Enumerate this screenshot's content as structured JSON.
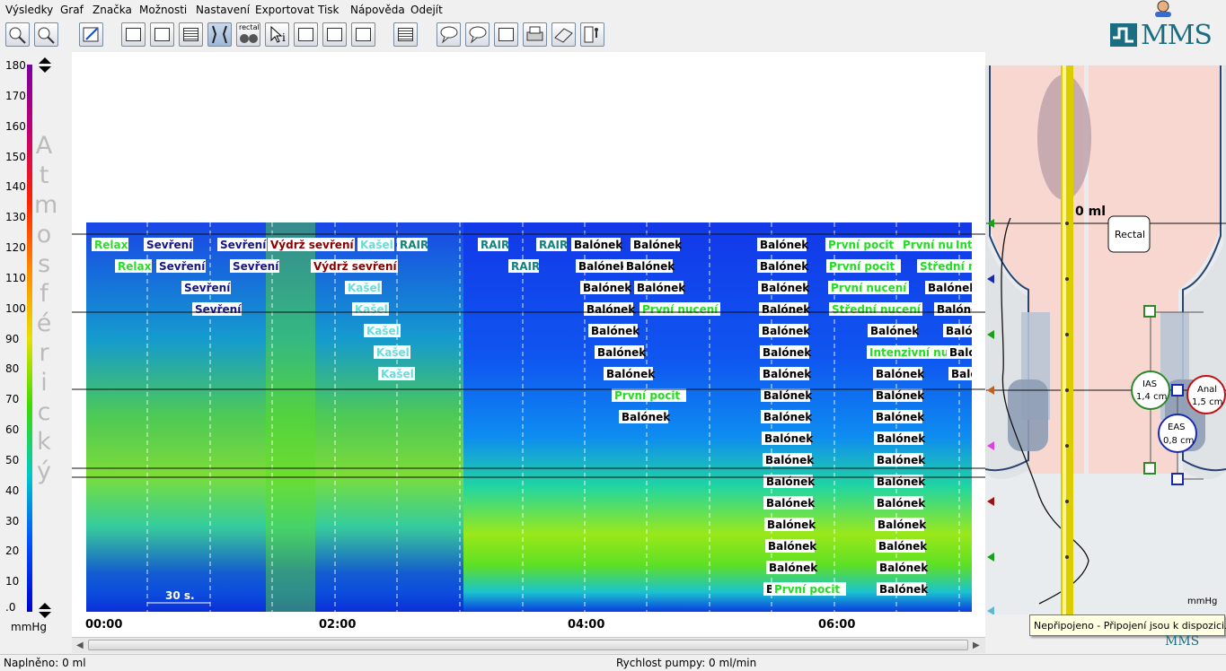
{
  "menu": [
    "Výsledky",
    "Graf",
    "Značka",
    "Možnosti",
    "Nastavení",
    "Exportovat",
    "Tisk",
    "Nápověda",
    "Odejít"
  ],
  "toolbar": {
    "rectal_label": "rectal",
    "logo_text": "MMS"
  },
  "yaxis": {
    "ticks": [
      "180",
      "170",
      "160",
      "150",
      "140",
      "130",
      "120",
      "110",
      "100",
      "90",
      "80",
      "70",
      "60",
      "50",
      "40",
      "30",
      "20",
      "10",
      ".0"
    ],
    "vertical_label": "A\nt\nm\no\ns\nf\né\nr\ni\nc\nk\ný",
    "unit": "mmHg"
  },
  "xaxis": {
    "ticks": [
      "00:00",
      "02:00",
      "04:00",
      "06:00"
    ]
  },
  "scale_label": "30 s.",
  "colors": {
    "accent": "#1a6e82",
    "relax": "#2bdc2b",
    "sevreni": "#14148c",
    "vydrz": "#8c0000",
    "kasel": "#66dddd",
    "rair": "#158080",
    "balonek": "#000000",
    "prvni": "#22dd22"
  },
  "markers": [
    {
      "label": "Relax",
      "color": "#2bdc2b"
    },
    {
      "label": "Relax",
      "color": "#2bdc2b"
    },
    {
      "label": "Sevření",
      "color": "#14148c"
    },
    {
      "label": "Sevření",
      "color": "#14148c"
    },
    {
      "label": "Sevření",
      "color": "#14148c"
    },
    {
      "label": "Sevření",
      "color": "#14148c"
    },
    {
      "label": "Sevření",
      "color": "#14148c"
    },
    {
      "label": "Sevření",
      "color": "#14148c"
    },
    {
      "label": "Výdrž sevření",
      "color": "#8c0000"
    },
    {
      "label": "Výdrž sevření",
      "color": "#8c0000"
    },
    {
      "label": "Kašel",
      "color": "#66dddd"
    },
    {
      "label": "Kašel",
      "color": "#66dddd"
    },
    {
      "label": "Kašel",
      "color": "#66dddd"
    },
    {
      "label": "Kašel",
      "color": "#66dddd"
    },
    {
      "label": "Kašel",
      "color": "#66dddd"
    },
    {
      "label": "Kašel",
      "color": "#66dddd"
    },
    {
      "label": "RAIR",
      "color": "#158080"
    },
    {
      "label": "RAIR",
      "color": "#158080"
    },
    {
      "label": "RAIR",
      "color": "#158080"
    },
    {
      "label": "RAIR",
      "color": "#158080"
    },
    {
      "label": "Balónek",
      "color": "#000000"
    },
    {
      "label": "Balónek",
      "color": "#000000"
    },
    {
      "label": "Balónek",
      "color": "#000000"
    },
    {
      "label": "Balónek",
      "color": "#000000"
    },
    {
      "label": "Balónek",
      "color": "#000000"
    },
    {
      "label": "Balónek",
      "color": "#000000"
    },
    {
      "label": "Balónek",
      "color": "#000000"
    },
    {
      "label": "Balónek",
      "color": "#000000"
    },
    {
      "label": "Balónek",
      "color": "#000000"
    },
    {
      "label": "Balónek",
      "color": "#000000"
    },
    {
      "label": "První nucení",
      "color": "#22dd22"
    },
    {
      "label": "První pocit",
      "color": "#22dd22"
    },
    {
      "label": "Balónek",
      "color": "#000000"
    },
    {
      "label": "Balónek",
      "color": "#000000"
    },
    {
      "label": "Balónek",
      "color": "#000000"
    },
    {
      "label": "Balónek",
      "color": "#000000"
    },
    {
      "label": "Balónek",
      "color": "#000000"
    },
    {
      "label": "Balónek",
      "color": "#000000"
    },
    {
      "label": "Balónek",
      "color": "#000000"
    },
    {
      "label": "Balónek",
      "color": "#000000"
    },
    {
      "label": "Balónek",
      "color": "#000000"
    },
    {
      "label": "Balónek",
      "color": "#000000"
    },
    {
      "label": "Balónek",
      "color": "#000000"
    },
    {
      "label": "Balónek",
      "color": "#000000"
    },
    {
      "label": "Balónek",
      "color": "#000000"
    },
    {
      "label": "Balónek",
      "color": "#000000"
    },
    {
      "label": "Balónek",
      "color": "#000000"
    },
    {
      "label": "Balónek",
      "color": "#000000"
    },
    {
      "label": "Balónek",
      "color": "#000000"
    },
    {
      "label": "Balónek",
      "color": "#000000"
    },
    {
      "label": "Balónek",
      "color": "#000000"
    },
    {
      "label": "První pocit",
      "color": "#22dd22"
    },
    {
      "label": "První pocit",
      "color": "#22dd22"
    },
    {
      "label": "První nucení",
      "color": "#22dd22"
    },
    {
      "label": "Střední nucení",
      "color": "#22dd22"
    },
    {
      "label": "Intenzivní nucení",
      "color": "#22dd22"
    },
    {
      "label": "První pocit",
      "color": "#22dd22"
    },
    {
      "label": "První nucení",
      "color": "#22dd22"
    },
    {
      "label": "Balónek",
      "color": "#000000"
    },
    {
      "label": "Balónek",
      "color": "#000000"
    },
    {
      "label": "Balónek",
      "color": "#000000"
    },
    {
      "label": "Balónek",
      "color": "#000000"
    },
    {
      "label": "Balónek",
      "color": "#000000"
    },
    {
      "label": "Balónek",
      "color": "#000000"
    },
    {
      "label": "Balónek",
      "color": "#000000"
    },
    {
      "label": "Balónek",
      "color": "#000000"
    },
    {
      "label": "Balónek",
      "color": "#000000"
    },
    {
      "label": "Balónek",
      "color": "#000000"
    },
    {
      "label": "Balónek",
      "color": "#000000"
    },
    {
      "label": "Balónek",
      "color": "#000000"
    },
    {
      "label": "Balónek",
      "color": "#000000"
    },
    {
      "label": "Inte",
      "color": "#22dd22"
    },
    {
      "label": "Střední n",
      "color": "#22dd22"
    },
    {
      "label": "Balónek",
      "color": "#000000"
    },
    {
      "label": "Balón",
      "color": "#000000"
    },
    {
      "label": "Balón",
      "color": "#000000"
    },
    {
      "label": "Baló",
      "color": "#000000"
    }
  ],
  "anatomy": {
    "volume": "0 ml",
    "rectal": "Rectal",
    "ias": "IAS",
    "ias_len": "1,4 cm",
    "eas": "EAS",
    "eas_len": "0,8 cm",
    "anal": "Anal",
    "anal_len": "1,5 cm",
    "unit": "mmHg",
    "sensor_colors": [
      "#19a019",
      "#1a2ab0",
      "#19a019",
      "#c06020",
      "#e040e0",
      "#a01010",
      "#19a019",
      "#5fb8d0"
    ]
  },
  "status": {
    "filled": "Naplněno: 0 ml",
    "pump": "Rychlost pumpy: 0 ml/min",
    "tooltip": "Nepřipojeno - Připojení jsou k dispozici.",
    "mms_small": "MMS"
  }
}
